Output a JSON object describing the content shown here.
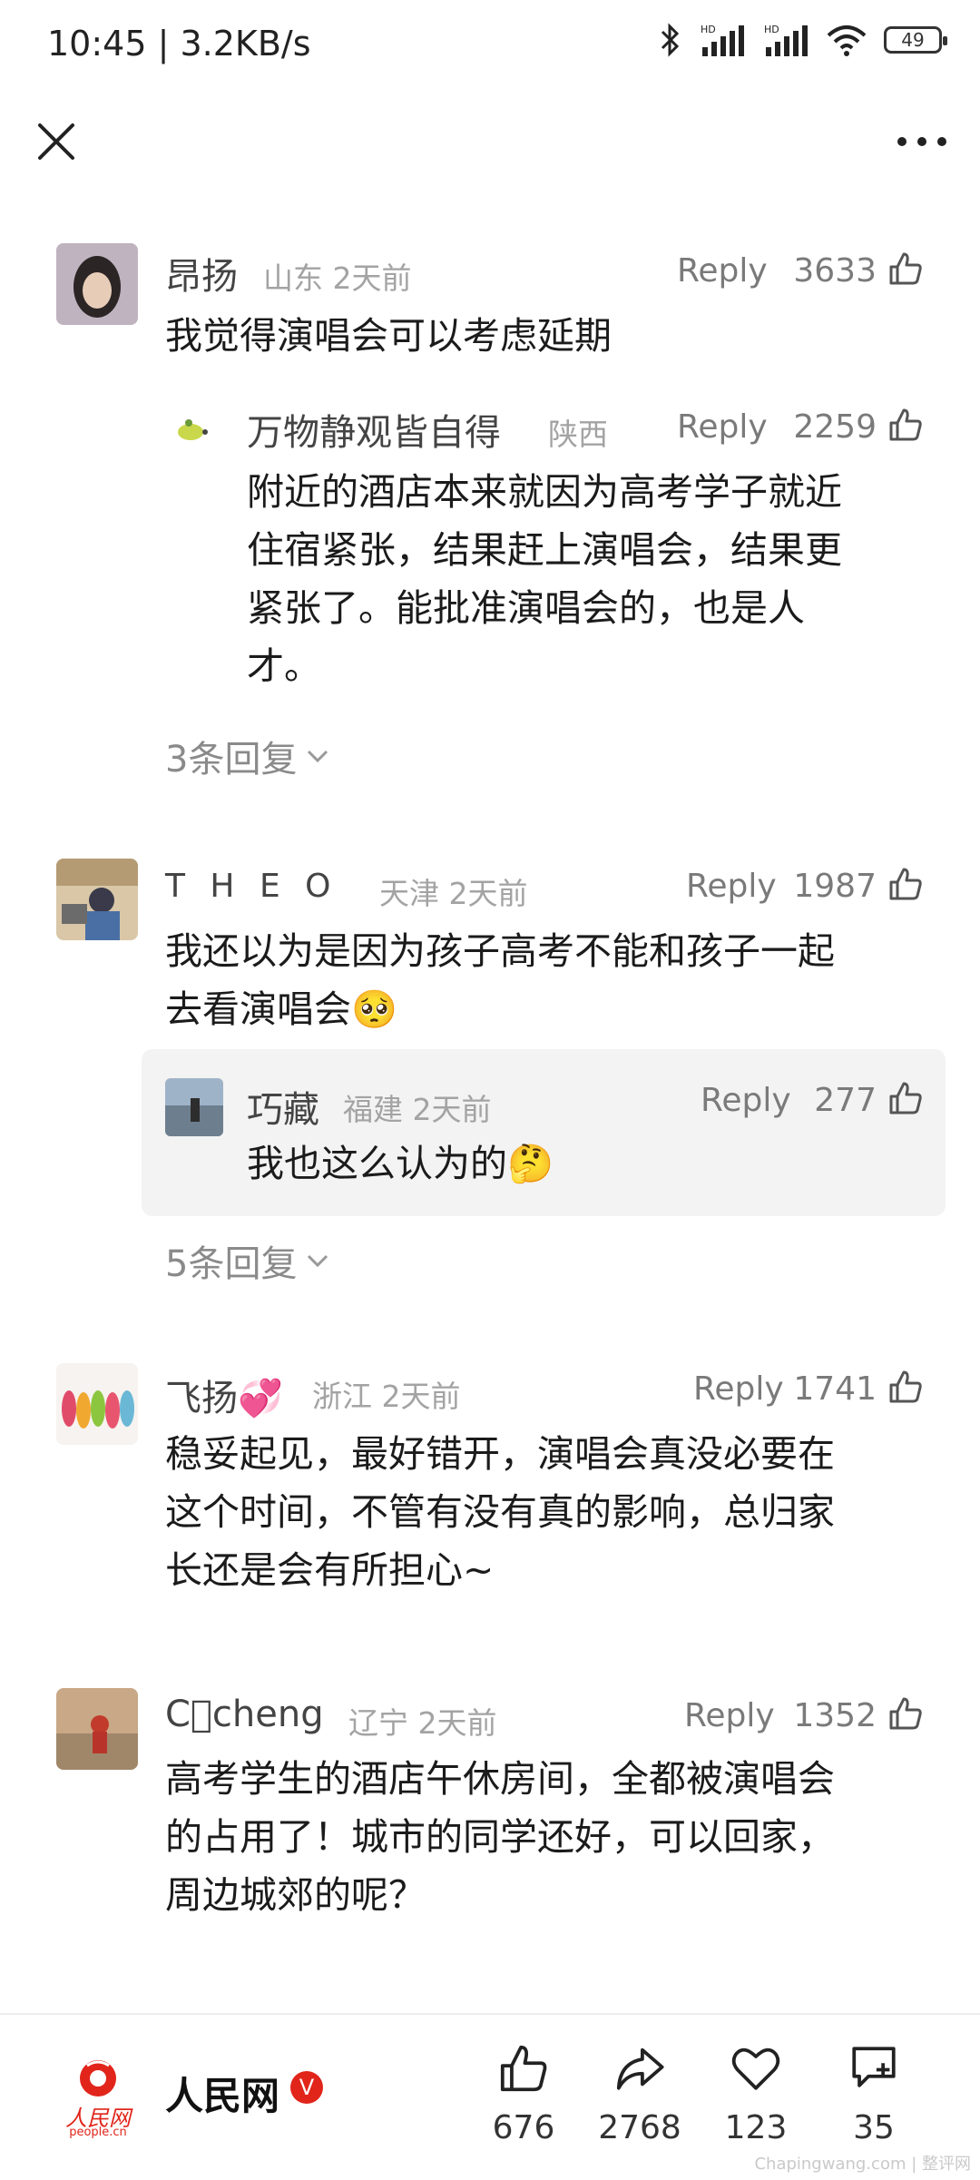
{
  "status_bar": {
    "time": "10:45",
    "speed": "3.2KB/s",
    "battery": "49"
  },
  "comments": [
    {
      "user": "昂扬",
      "location": "山东",
      "time": "2天前",
      "reply_label": "Reply",
      "likes": "3633",
      "lines": [
        "我觉得演唱会可以考虑延期"
      ]
    },
    {
      "user": "T H E O",
      "location": "天津",
      "time": "2天前",
      "reply_label": "Reply",
      "likes": "1987",
      "lines": [
        "我还以为是因为孩子高考不能和孩子一起",
        "去看演唱会🥺"
      ]
    },
    {
      "user": "飞扬💞",
      "location": "浙江",
      "time": "2天前",
      "reply_label": "Reply",
      "likes": "1741",
      "lines": [
        "稳妥起见，最好错开，演唱会真没必要在",
        "这个时间，不管有没有真的影响，总归家",
        "长还是会有所担心~"
      ]
    },
    {
      "user": "C􀀀cheng",
      "location": "辽宁",
      "time": "2天前",
      "reply_label": "Reply",
      "likes": "1352",
      "lines": [
        "高考学生的酒店午休房间，全都被演唱会",
        "的占用了！城市的同学还好，可以回家，",
        "周边城郊的呢？"
      ]
    }
  ],
  "replies": [
    {
      "user": "万物静观皆自得",
      "location": "陕西",
      "reply_label": "Reply",
      "likes": "2259",
      "lines": [
        "附近的酒店本来就因为高考学子就近",
        "住宿紧张，结果赶上演唱会，结果更",
        "紧张了。能批准演唱会的，也是人",
        "才。"
      ]
    },
    {
      "user": "巧藏",
      "location": "福建",
      "time": "2天前",
      "reply_label": "Reply",
      "likes": "277",
      "lines": [
        "我也这么认为的🤔"
      ]
    }
  ],
  "more_replies": [
    "3条回复",
    "5条回复"
  ],
  "bottom": {
    "brand": "人民网",
    "logo_text": "人民网",
    "logo_sub": "people.cn",
    "verified": "V",
    "like_count": "676",
    "share_count": "2768",
    "fav_count": "123",
    "comment_count": "35"
  },
  "watermark": "Chapingwang.com | 整评网",
  "colors": {
    "accent_red": "#e1251b",
    "reply_bg": "#f3f3f3"
  }
}
